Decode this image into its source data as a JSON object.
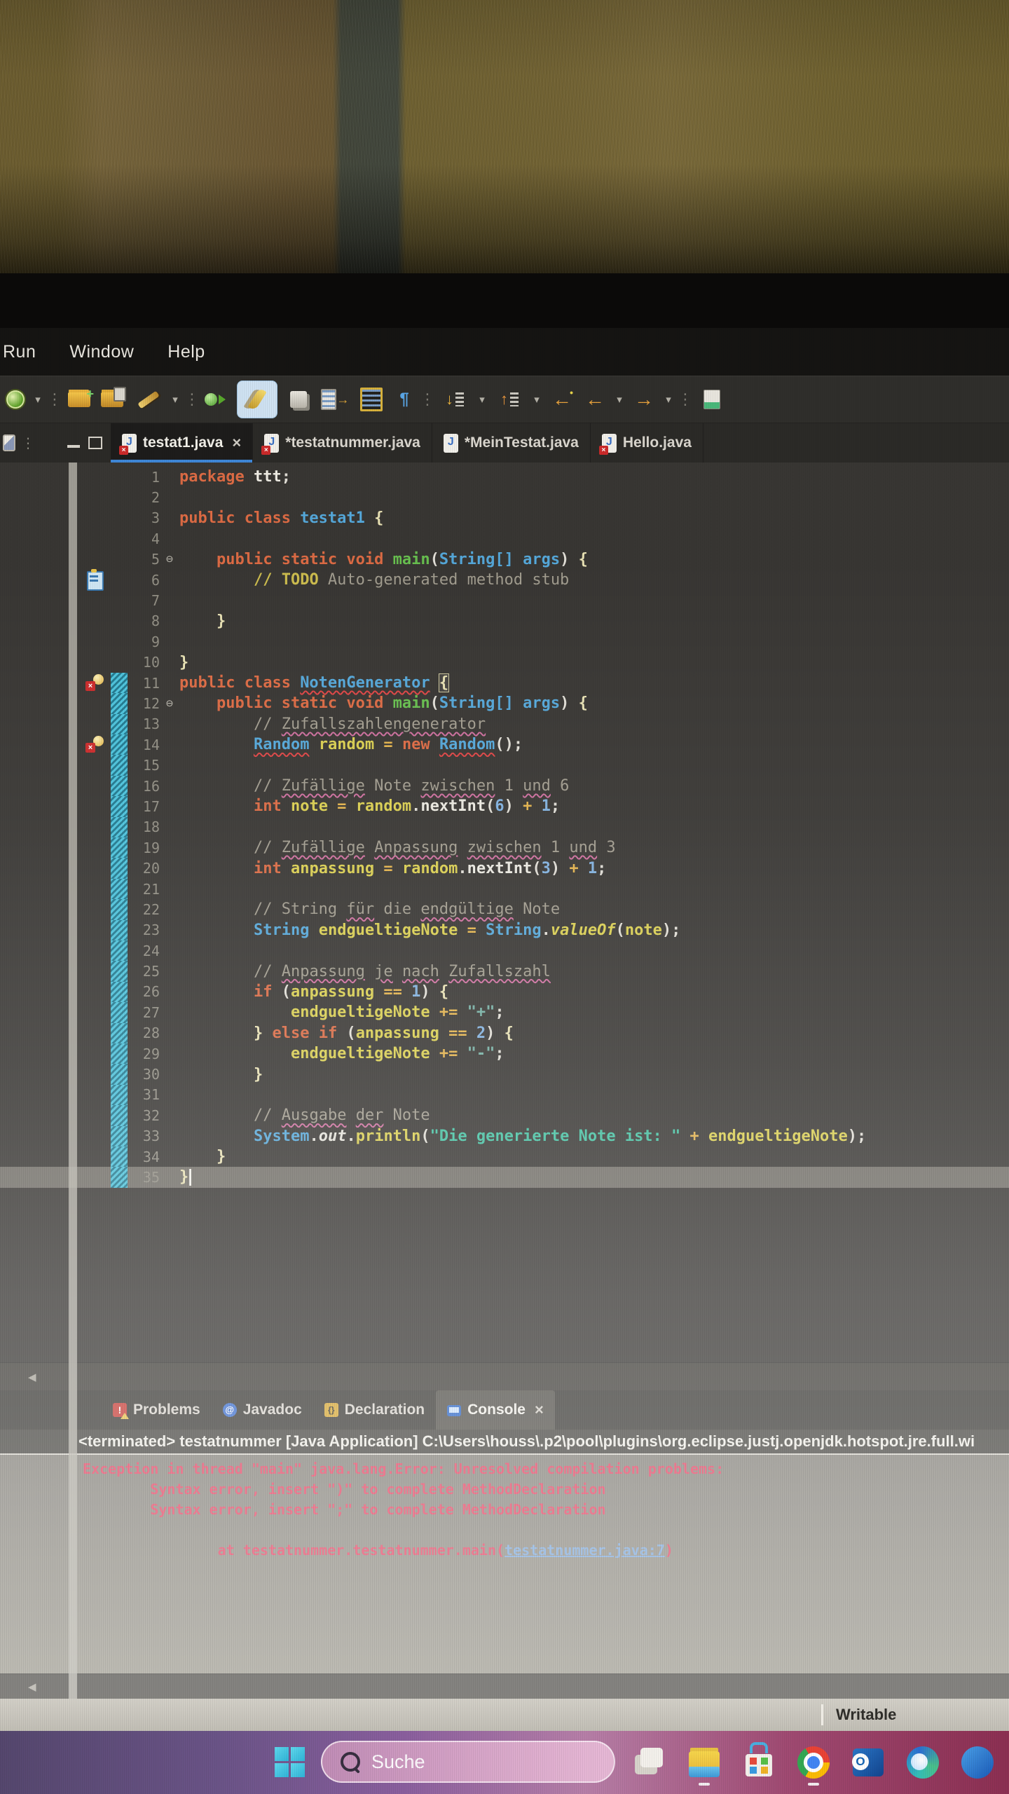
{
  "window": {
    "menu_items": [
      "Run",
      "Window",
      "Help"
    ]
  },
  "toolbar": {
    "icons": [
      {
        "name": "external-tools-icon",
        "kind": "k-run"
      },
      {
        "name": "external-tools-dropdown",
        "kind": "k-dd",
        "glyph": "▾"
      },
      {
        "name": "toolbar-separator-icon",
        "kind": "k-sep",
        "glyph": "⋮"
      },
      {
        "name": "new-folder-icon",
        "kind": "k-folder"
      },
      {
        "name": "save-all-icon",
        "kind": "k-folder2"
      },
      {
        "name": "print-icon",
        "kind": "k-pen"
      },
      {
        "name": "print-dropdown",
        "kind": "k-dd",
        "glyph": "▾"
      },
      {
        "name": "toolbar-separator-icon",
        "kind": "k-sep",
        "glyph": "⋮"
      },
      {
        "name": "debug-icon",
        "kind": "k-debug"
      },
      {
        "name": "coverage-icon",
        "kind": "k-feather"
      },
      {
        "name": "run-as-icon",
        "kind": "k-runas"
      },
      {
        "name": "new-class-icon",
        "kind": "k-docarrow"
      },
      {
        "name": "open-type-icon",
        "kind": "k-docgrid"
      },
      {
        "name": "show-whitespace-icon",
        "kind": "k-pilcrow",
        "glyph": "¶"
      },
      {
        "name": "toolbar-separator-icon",
        "kind": "k-sep",
        "glyph": "⋮"
      },
      {
        "name": "next-annotation-icon",
        "kind": "k-downdoc",
        "glyph": "↓"
      },
      {
        "name": "next-annotation-dropdown",
        "kind": "k-dd",
        "glyph": "▾"
      },
      {
        "name": "previous-annotation-icon",
        "kind": "k-updoc",
        "glyph": "↑"
      },
      {
        "name": "previous-annotation-dropdown",
        "kind": "k-dd",
        "glyph": "▾"
      },
      {
        "name": "last-edit-location-icon",
        "kind": "k-goldarrow",
        "glyph": "←"
      },
      {
        "name": "back-icon",
        "kind": "k-backfwd",
        "glyph": "←"
      },
      {
        "name": "back-dropdown",
        "kind": "k-dd",
        "glyph": "▾"
      },
      {
        "name": "forward-icon",
        "kind": "k-backfwd",
        "glyph": "→"
      },
      {
        "name": "forward-dropdown",
        "kind": "k-dd",
        "glyph": "▾"
      },
      {
        "name": "toolbar-separator-icon",
        "kind": "k-sep",
        "glyph": "⋮"
      },
      {
        "name": "open-console-icon",
        "kind": "k-greendoc"
      }
    ]
  },
  "editor_tabs": [
    {
      "label": "testat1.java",
      "active": true,
      "error_badge": true,
      "closable": true
    },
    {
      "label": "*testatnummer.java",
      "active": false,
      "error_badge": true,
      "closable": false
    },
    {
      "label": "*MeinTestat.java",
      "active": false,
      "error_badge": false,
      "closable": false
    },
    {
      "label": "Hello.java",
      "active": false,
      "error_badge": true,
      "closable": false
    }
  ],
  "editor": {
    "lines": [
      {
        "n": 1,
        "tokens": [
          [
            "kw",
            "package "
          ],
          [
            "bold",
            "ttt"
          ],
          [
            "pln",
            ";"
          ]
        ]
      },
      {
        "n": 2,
        "tokens": []
      },
      {
        "n": 3,
        "tokens": [
          [
            "kw",
            "public class "
          ],
          [
            "cls",
            "testat1"
          ],
          [
            "pln",
            " "
          ],
          [
            "brc",
            "{"
          ]
        ]
      },
      {
        "n": 4,
        "tokens": []
      },
      {
        "n": 5,
        "fold": true,
        "tokens": [
          [
            "pln",
            "    "
          ],
          [
            "kw",
            "public static void "
          ],
          [
            "mth",
            "main"
          ],
          [
            "pln",
            "("
          ],
          [
            "cls",
            "String"
          ],
          [
            "cls",
            "[]"
          ],
          [
            "pln",
            " "
          ],
          [
            "prm",
            "args"
          ],
          [
            "pln",
            ") "
          ],
          [
            "brc",
            "{"
          ]
        ]
      },
      {
        "n": 6,
        "task": true,
        "tokens": [
          [
            "pln",
            "        "
          ],
          [
            "task",
            "// TODO"
          ],
          [
            "cmt",
            " Auto-generated method stub"
          ]
        ]
      },
      {
        "n": 7,
        "tokens": []
      },
      {
        "n": 8,
        "tokens": [
          [
            "pln",
            "    "
          ],
          [
            "brc",
            "}"
          ]
        ]
      },
      {
        "n": 9,
        "tokens": []
      },
      {
        "n": 10,
        "tokens": [
          [
            "brc",
            "}"
          ]
        ]
      },
      {
        "n": 11,
        "error": true,
        "hatch": true,
        "tokens": [
          [
            "kw",
            "public class "
          ],
          [
            "clserr",
            "NotenGenerator"
          ],
          [
            "pln",
            " "
          ],
          [
            "brcbox",
            "{"
          ]
        ]
      },
      {
        "n": 12,
        "fold": true,
        "hatch": true,
        "tokens": [
          [
            "pln",
            "    "
          ],
          [
            "kw",
            "public static void "
          ],
          [
            "mth",
            "main"
          ],
          [
            "pln",
            "("
          ],
          [
            "cls",
            "String"
          ],
          [
            "cls",
            "[]"
          ],
          [
            "pln",
            " "
          ],
          [
            "prm",
            "args"
          ],
          [
            "pln",
            ") "
          ],
          [
            "brc",
            "{"
          ]
        ]
      },
      {
        "n": 13,
        "hatch": true,
        "tokens": [
          [
            "pln",
            "        "
          ],
          [
            "cmt",
            "// "
          ],
          [
            "spell",
            "Zufallszahlengenerator"
          ]
        ]
      },
      {
        "n": 14,
        "error": true,
        "hatch": true,
        "tokens": [
          [
            "pln",
            "        "
          ],
          [
            "clserr",
            "Random"
          ],
          [
            "pln",
            " "
          ],
          [
            "var",
            "random"
          ],
          [
            "op",
            " = "
          ],
          [
            "kw",
            "new"
          ],
          [
            "pln",
            " "
          ],
          [
            "clserr",
            "Random"
          ],
          [
            "pln",
            "();"
          ]
        ]
      },
      {
        "n": 15,
        "hatch": true,
        "tokens": []
      },
      {
        "n": 16,
        "hatch": true,
        "tokens": [
          [
            "pln",
            "        "
          ],
          [
            "cmt",
            "// "
          ],
          [
            "spell",
            "Zufällige"
          ],
          [
            "cmt",
            " Note "
          ],
          [
            "spell",
            "zwischen"
          ],
          [
            "cmt",
            " 1 "
          ],
          [
            "spell",
            "und"
          ],
          [
            "cmt",
            " 6"
          ]
        ]
      },
      {
        "n": 17,
        "hatch": true,
        "tokens": [
          [
            "pln",
            "        "
          ],
          [
            "kw",
            "int "
          ],
          [
            "var",
            "note"
          ],
          [
            "op",
            " = "
          ],
          [
            "var",
            "random"
          ],
          [
            "pln",
            "."
          ],
          [
            "mc",
            "nextInt"
          ],
          [
            "pln",
            "("
          ],
          [
            "num",
            "6"
          ],
          [
            "pln",
            ") "
          ],
          [
            "op",
            "+"
          ],
          [
            "pln",
            " "
          ],
          [
            "num",
            "1"
          ],
          [
            "pln",
            ";"
          ]
        ]
      },
      {
        "n": 18,
        "hatch": true,
        "tokens": []
      },
      {
        "n": 19,
        "hatch": true,
        "tokens": [
          [
            "pln",
            "        "
          ],
          [
            "cmt",
            "// "
          ],
          [
            "spell",
            "Zufällige"
          ],
          [
            "cmt",
            " "
          ],
          [
            "spell",
            "Anpassung"
          ],
          [
            "cmt",
            " "
          ],
          [
            "spell",
            "zwischen"
          ],
          [
            "cmt",
            " 1 "
          ],
          [
            "spell",
            "und"
          ],
          [
            "cmt",
            " 3"
          ]
        ]
      },
      {
        "n": 20,
        "hatch": true,
        "tokens": [
          [
            "pln",
            "        "
          ],
          [
            "kw",
            "int "
          ],
          [
            "var",
            "anpassung"
          ],
          [
            "op",
            " = "
          ],
          [
            "var",
            "random"
          ],
          [
            "pln",
            "."
          ],
          [
            "mc",
            "nextInt"
          ],
          [
            "pln",
            "("
          ],
          [
            "num",
            "3"
          ],
          [
            "pln",
            ") "
          ],
          [
            "op",
            "+"
          ],
          [
            "pln",
            " "
          ],
          [
            "num",
            "1"
          ],
          [
            "pln",
            ";"
          ]
        ]
      },
      {
        "n": 21,
        "hatch": true,
        "tokens": []
      },
      {
        "n": 22,
        "hatch": true,
        "tokens": [
          [
            "pln",
            "        "
          ],
          [
            "cmt",
            "// String "
          ],
          [
            "spell",
            "für"
          ],
          [
            "cmt",
            " die "
          ],
          [
            "spell",
            "endgültige"
          ],
          [
            "cmt",
            " Note"
          ]
        ]
      },
      {
        "n": 23,
        "hatch": true,
        "tokens": [
          [
            "pln",
            "        "
          ],
          [
            "cls",
            "String"
          ],
          [
            "pln",
            " "
          ],
          [
            "var",
            "endgueltigeNote"
          ],
          [
            "op",
            " = "
          ],
          [
            "cls",
            "String"
          ],
          [
            "pln",
            "."
          ],
          [
            "mi",
            "valueOf"
          ],
          [
            "pln",
            "("
          ],
          [
            "var",
            "note"
          ],
          [
            "pln",
            ");"
          ]
        ]
      },
      {
        "n": 24,
        "hatch": true,
        "tokens": []
      },
      {
        "n": 25,
        "hatch": true,
        "tokens": [
          [
            "pln",
            "        "
          ],
          [
            "cmt",
            "// "
          ],
          [
            "spell",
            "Anpassung"
          ],
          [
            "cmt",
            " "
          ],
          [
            "spell",
            "je"
          ],
          [
            "cmt",
            " "
          ],
          [
            "spell",
            "nach"
          ],
          [
            "cmt",
            " "
          ],
          [
            "spell",
            "Zufallszahl"
          ]
        ]
      },
      {
        "n": 26,
        "hatch": true,
        "tokens": [
          [
            "pln",
            "        "
          ],
          [
            "kw",
            "if"
          ],
          [
            "pln",
            " ("
          ],
          [
            "var",
            "anpassung"
          ],
          [
            "op",
            " == "
          ],
          [
            "num",
            "1"
          ],
          [
            "pln",
            ") "
          ],
          [
            "brc",
            "{"
          ]
        ]
      },
      {
        "n": 27,
        "hatch": true,
        "tokens": [
          [
            "pln",
            "            "
          ],
          [
            "var",
            "endgueltigeNote"
          ],
          [
            "op",
            " += "
          ],
          [
            "strq",
            "\"+\""
          ],
          [
            "pln",
            ";"
          ]
        ]
      },
      {
        "n": 28,
        "hatch": true,
        "tokens": [
          [
            "pln",
            "        "
          ],
          [
            "brc",
            "} "
          ],
          [
            "kw",
            "else if"
          ],
          [
            "pln",
            " ("
          ],
          [
            "var",
            "anpassung"
          ],
          [
            "op",
            " == "
          ],
          [
            "num",
            "2"
          ],
          [
            "pln",
            ") "
          ],
          [
            "brc",
            "{"
          ]
        ]
      },
      {
        "n": 29,
        "hatch": true,
        "tokens": [
          [
            "pln",
            "            "
          ],
          [
            "var",
            "endgueltigeNote"
          ],
          [
            "op",
            " += "
          ],
          [
            "strq",
            "\"-\""
          ],
          [
            "pln",
            ";"
          ]
        ]
      },
      {
        "n": 30,
        "hatch": true,
        "tokens": [
          [
            "pln",
            "        "
          ],
          [
            "brc",
            "}"
          ]
        ]
      },
      {
        "n": 31,
        "hatch": true,
        "tokens": []
      },
      {
        "n": 32,
        "hatch": true,
        "tokens": [
          [
            "pln",
            "        "
          ],
          [
            "cmt",
            "// "
          ],
          [
            "spell",
            "Ausgabe"
          ],
          [
            "cmt",
            " "
          ],
          [
            "spell",
            "der"
          ],
          [
            "cmt",
            " Note"
          ]
        ]
      },
      {
        "n": 33,
        "hatch": true,
        "tokens": [
          [
            "pln",
            "        "
          ],
          [
            "cls",
            "System"
          ],
          [
            "pln",
            "."
          ],
          [
            "fld",
            "out"
          ],
          [
            "pln",
            "."
          ],
          [
            "mcy",
            "println"
          ],
          [
            "pln",
            "("
          ],
          [
            "str",
            "\"Die generierte Note ist: \""
          ],
          [
            "op",
            " + "
          ],
          [
            "var",
            "endgueltigeNote"
          ],
          [
            "pln",
            ");"
          ]
        ]
      },
      {
        "n": 34,
        "hatch": true,
        "tokens": [
          [
            "pln",
            "    "
          ],
          [
            "brc",
            "}"
          ]
        ]
      },
      {
        "n": 35,
        "hatch": true,
        "current": true,
        "cursor": true,
        "tokens": [
          [
            "brc",
            "}"
          ]
        ]
      }
    ]
  },
  "console": {
    "tabs": [
      {
        "label": "Problems",
        "icon": "problems-icon",
        "ci": "ci-problems",
        "glyph": "!"
      },
      {
        "label": "Javadoc",
        "icon": "javadoc-icon",
        "ci": "ci-javadoc",
        "glyph": "@"
      },
      {
        "label": "Declaration",
        "icon": "declaration-icon",
        "ci": "ci-declaration",
        "glyph": "{}"
      },
      {
        "label": "Console",
        "icon": "console-icon",
        "ci": "ci-console",
        "glyph": "",
        "active": true,
        "closable": true
      }
    ],
    "close_glyph": "×",
    "terminated_line": "<terminated> testatnummer [Java Application] C:\\Users\\houss\\.p2\\pool\\plugins\\org.eclipse.justj.openjdk.hotspot.jre.full.wi",
    "output_lines": [
      {
        "text": "Exception in thread \"main\" java.lang.Error: Unresolved compilation problems: "
      },
      {
        "text": "        Syntax error, insert \")\" to complete MethodDeclaration"
      },
      {
        "text": "        Syntax error, insert \";\" to complete MethodDeclaration"
      },
      {
        "text": ""
      },
      {
        "prefix": "                at testatnummer.testatnummer.main(",
        "link": "testatnummer.java:7",
        "suffix": ")"
      }
    ]
  },
  "statusbar": {
    "writable": "Writable"
  },
  "taskbar": {
    "search_label": "Suche",
    "icons": [
      {
        "name": "task-view-icon",
        "kind": "ti-taskview",
        "running": false
      },
      {
        "name": "file-explorer-icon",
        "kind": "ti-explorer",
        "running": true
      },
      {
        "name": "microsoft-store-icon",
        "kind": "ti-store",
        "running": false
      },
      {
        "name": "chrome-icon",
        "kind": "ti-chrome",
        "running": true
      },
      {
        "name": "outlook-icon",
        "kind": "ti-outlook",
        "running": false
      },
      {
        "name": "edge-icon",
        "kind": "ti-edge",
        "running": false
      },
      {
        "name": "app-partial-icon",
        "kind": "ti-partial",
        "running": false
      }
    ]
  }
}
